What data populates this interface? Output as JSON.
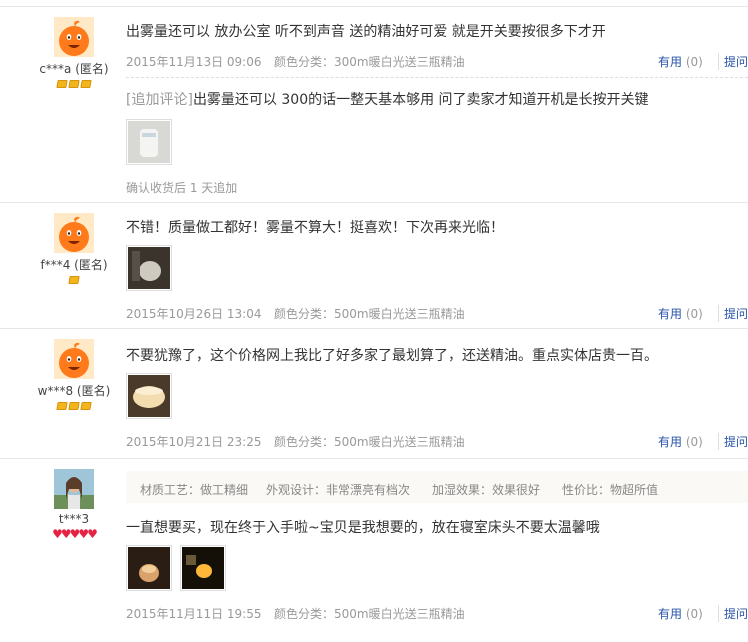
{
  "reviews": [
    {
      "user": "c***a (匿名)",
      "text": "出雾量还可以 放办公室 听不到声音 送的精油好可爱 就是开关要按很多下才开",
      "date": "2015年11月13日 09:06",
      "color_class": "颜色分类：300m暖白光送三瓶精油",
      "useful_label": "有用",
      "useful_count": "(0)",
      "ask": "提问",
      "append_tag": "[追加评论]",
      "append_text": "出雾量还可以 300的话一整天基本够用 问了卖家才知道开机是长按开关键",
      "append_note": "确认收货后 1 天追加"
    },
    {
      "user": "f***4 (匿名)",
      "text": "不错！质量做工都好！雾量不算大！挺喜欢！下次再来光临！",
      "date": "2015年10月26日 13:04",
      "color_class": "颜色分类：500m暖白光送三瓶精油",
      "useful_label": "有用",
      "useful_count": "(0)",
      "ask": "提问"
    },
    {
      "user": "w***8 (匿名)",
      "text": "不要犹豫了，这个价格网上我比了好多家了最划算了，还送精油。重点实体店贵一百。",
      "date": "2015年10月21日 23:25",
      "color_class": "颜色分类：500m暖白光送三瓶精油",
      "useful_label": "有用",
      "useful_count": "(0)",
      "ask": "提问"
    },
    {
      "user": "t***3",
      "tags": [
        "材质工艺：做工精细",
        "外观设计：非常漂亮有档次",
        "加湿效果：效果很好",
        "性价比：物超所值"
      ],
      "text": "一直想要买，现在终于入手啦~宝贝是我想要的，放在寝室床头不要太温馨哦",
      "date": "2015年11月11日 19:55",
      "color_class": "颜色分类：500m暖白光送三瓶精油",
      "useful_label": "有用",
      "useful_count": "(0)",
      "ask": "提问"
    }
  ],
  "icons": {
    "avatar": "orange-mascot-icon",
    "rank_gem": "diamond-icon",
    "rank_heart": "heart-icon"
  },
  "colors": {
    "link": "#2953a6",
    "gem": "#f2b51c",
    "heart": "#e62244"
  }
}
